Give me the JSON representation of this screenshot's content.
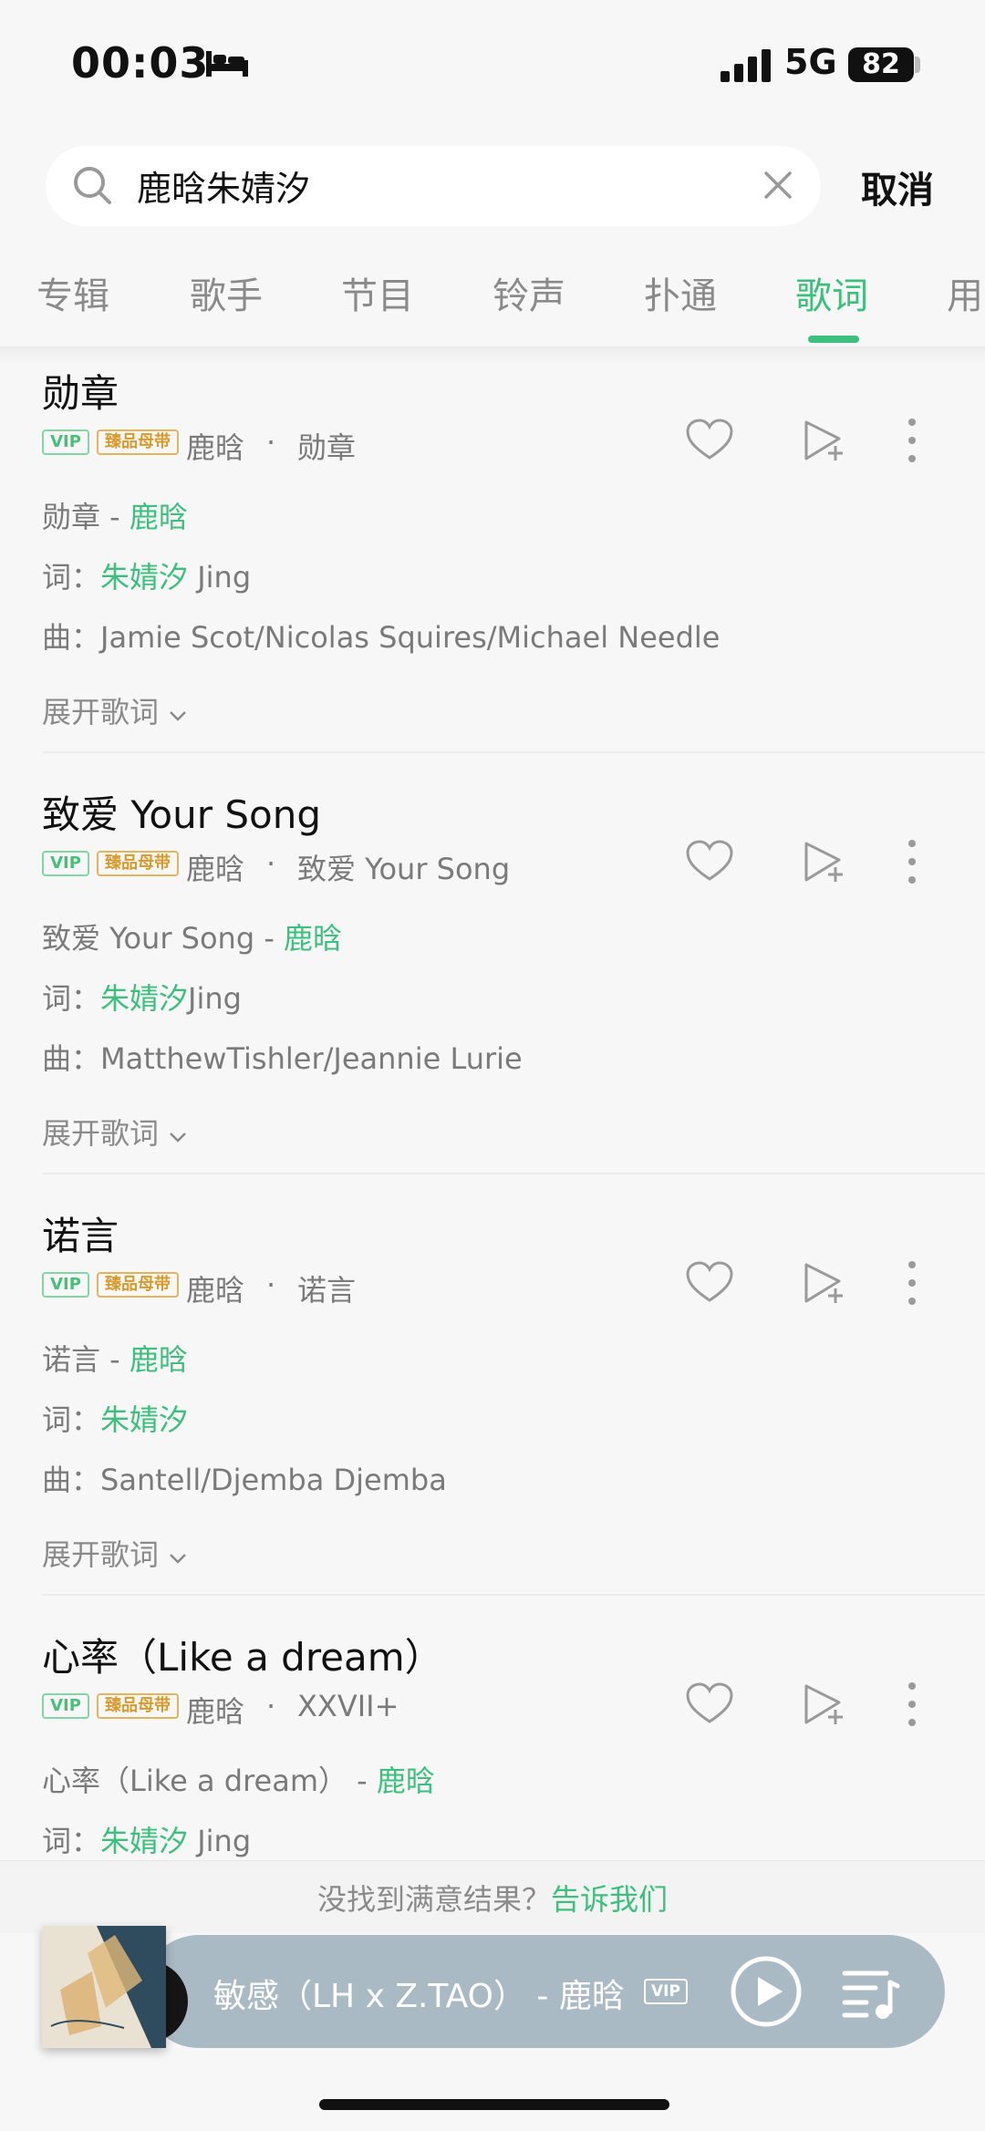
{
  "status_bar": {
    "time": "00:03",
    "network": "5G",
    "battery": "82"
  },
  "search": {
    "query": "鹿晗朱婧汐",
    "cancel_label": "取消"
  },
  "tabs": [
    {
      "label": "专辑"
    },
    {
      "label": "歌手"
    },
    {
      "label": "节目"
    },
    {
      "label": "铃声"
    },
    {
      "label": "扑通"
    },
    {
      "label": "歌词",
      "active": true
    },
    {
      "label": "用"
    }
  ],
  "badges": {
    "vip": "VIP",
    "quality": "臻品母带"
  },
  "results": [
    {
      "title": "勋章",
      "artist": "鹿晗",
      "dot": "·",
      "album": "勋章",
      "line1_prefix": "勋章 - ",
      "line1_artist": "鹿晗",
      "lyricist_label": "词：",
      "lyricist": "朱婧汐",
      "lyricist_suffix": " Jing",
      "composer_label": "曲：",
      "composer": "Jamie Scot/Nicolas Squires/Michael Needle",
      "expand_label": "展开歌词"
    },
    {
      "title": "致爱 Your Song",
      "artist": "鹿晗",
      "dot": "·",
      "album": "致爱 Your Song",
      "line1_prefix": "致爱 Your Song - ",
      "line1_artist": "鹿晗",
      "lyricist_label": "词：",
      "lyricist": "朱婧汐",
      "lyricist_suffix": "Jing",
      "composer_label": "曲：",
      "composer": "MatthewTishler/Jeannie Lurie",
      "expand_label": "展开歌词"
    },
    {
      "title": "诺言",
      "artist": "鹿晗",
      "dot": "·",
      "album": "诺言",
      "line1_prefix": "诺言 - ",
      "line1_artist": "鹿晗",
      "lyricist_label": "词：",
      "lyricist": "朱婧汐",
      "lyricist_suffix": "",
      "composer_label": "曲：",
      "composer": "Santell/Djemba Djemba",
      "expand_label": "展开歌词"
    },
    {
      "title": "心率（Like a dream）",
      "artist": "鹿晗",
      "dot": "·",
      "album": "XXVII+",
      "line1_prefix": "心率（Like a dream） - ",
      "line1_artist": "鹿晗",
      "lyricist_label": "词：",
      "lyricist": "朱婧汐",
      "lyricist_suffix": " Jing"
    }
  ],
  "feedback": {
    "text": "没找到满意结果？",
    "link": "告诉我们"
  },
  "player": {
    "now_playing": "敏感（LH x Z.TAO） - 鹿晗",
    "vip": "VIP"
  },
  "colors": {
    "accent": "#3dbf7d",
    "quality_badge": "#d89a2a",
    "player_bg": "#aabac5"
  }
}
